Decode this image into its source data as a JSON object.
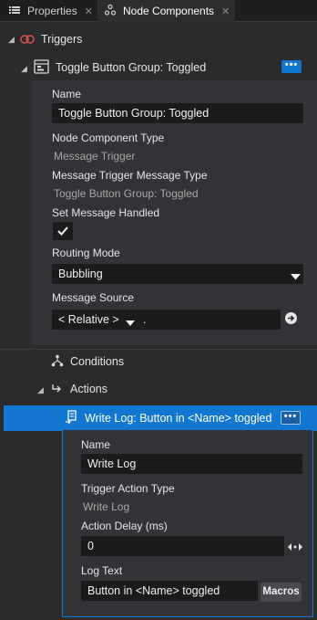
{
  "tabs": [
    {
      "label": "Properties",
      "icon": "list-icon",
      "close": "✕"
    },
    {
      "label": "Node Components",
      "icon": "node-components-icon",
      "close": "✕"
    }
  ],
  "triggers": {
    "label": "Triggers",
    "toggle_group": {
      "title": "Toggle Button Group: Toggled",
      "more": "•••",
      "name_label": "Name",
      "name_value": "Toggle Button Group: Toggled",
      "component_type_label": "Node Component Type",
      "component_type_value": "Message Trigger",
      "message_type_label": "Message Trigger Message Type",
      "message_type_value": "Toggle Button Group: Toggled",
      "handled_label": "Set Message Handled",
      "handled_checked": true,
      "routing_label": "Routing Mode",
      "routing_value": "Bubbling",
      "source_label": "Message Source",
      "source_relative": "< Relative >",
      "source_path": "."
    },
    "conditions_label": "Conditions",
    "actions_label": "Actions",
    "write_log": {
      "title": "Write Log: Button in <Name> toggled",
      "more": "•••",
      "name_label": "Name",
      "name_value": "Write Log",
      "action_type_label": "Trigger Action Type",
      "action_type_value": "Write Log",
      "delay_label": "Action Delay (ms)",
      "delay_value": "0",
      "log_label": "Log Text",
      "log_value": "Button in <Name> toggled",
      "macros_label": "Macros"
    }
  },
  "colors": {
    "accent": "#1177d1",
    "background": "#2b2b2b",
    "panel": "#333337",
    "input": "#1b1b1b"
  }
}
